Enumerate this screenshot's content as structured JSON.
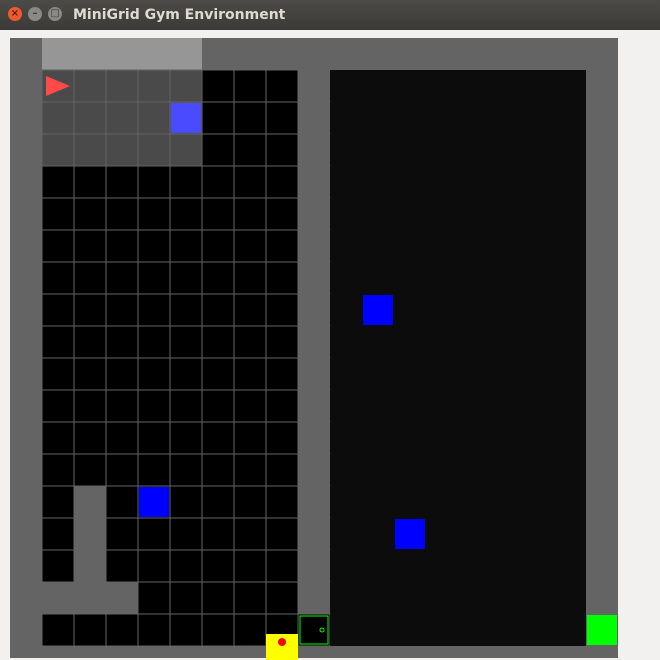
{
  "window": {
    "title": "MiniGrid Gym Environment",
    "close_glyph": "×",
    "minimize_glyph": "–",
    "maximize_glyph": "□"
  },
  "grid": {
    "cols": 19,
    "rows": 19,
    "colors": {
      "wall": "#646464",
      "floor": "#000000",
      "dark_floor": "#0c0c0c",
      "gridline": "#646464",
      "visible_tint": "#4a4a4a",
      "visible_wall": "#969696",
      "agent": "#ff4a4a",
      "box_blue": "#0000ff",
      "box_visible": "#4a4aff",
      "goal": "#00ff00",
      "door_yellow": "#ffff00",
      "key_red": "#ff0000",
      "door_green_outline": "#00ff00"
    },
    "agent": {
      "col": 1,
      "row": 1,
      "direction": "east"
    },
    "visible_cells": [
      [
        1,
        0
      ],
      [
        2,
        0
      ],
      [
        3,
        0
      ],
      [
        4,
        0
      ],
      [
        5,
        0
      ],
      [
        1,
        1
      ],
      [
        2,
        1
      ],
      [
        3,
        1
      ],
      [
        4,
        1
      ],
      [
        5,
        1
      ],
      [
        1,
        2
      ],
      [
        2,
        2
      ],
      [
        3,
        2
      ],
      [
        4,
        2
      ],
      [
        5,
        2
      ],
      [
        1,
        3
      ],
      [
        2,
        3
      ],
      [
        3,
        3
      ],
      [
        4,
        3
      ],
      [
        5,
        3
      ]
    ],
    "walls": [
      [
        2,
        14
      ],
      [
        2,
        15
      ],
      [
        2,
        16
      ],
      [
        2,
        17
      ],
      [
        1,
        17
      ],
      [
        3,
        17
      ],
      [
        9,
        1
      ],
      [
        9,
        2
      ],
      [
        9,
        3
      ],
      [
        9,
        4
      ],
      [
        9,
        5
      ],
      [
        9,
        6
      ],
      [
        9,
        7
      ],
      [
        9,
        8
      ],
      [
        9,
        9
      ],
      [
        9,
        10
      ],
      [
        9,
        11
      ],
      [
        9,
        12
      ],
      [
        9,
        13
      ],
      [
        9,
        14
      ],
      [
        9,
        15
      ],
      [
        9,
        16
      ],
      [
        9,
        17
      ]
    ],
    "boxes": [
      {
        "col": 5,
        "row": 2,
        "visible": true
      },
      {
        "col": 11,
        "row": 8,
        "visible": false
      },
      {
        "col": 4,
        "row": 14,
        "visible": false
      },
      {
        "col": 12,
        "row": 15,
        "visible": false
      }
    ],
    "goal": {
      "col": 18,
      "row": 18
    },
    "door_open": {
      "col": 9,
      "row": 18
    },
    "door_yellow": {
      "col": 8,
      "row": 19
    },
    "dark_region": {
      "col_start": 10,
      "col_end": 18,
      "row_start": 1,
      "row_end": 18
    }
  }
}
